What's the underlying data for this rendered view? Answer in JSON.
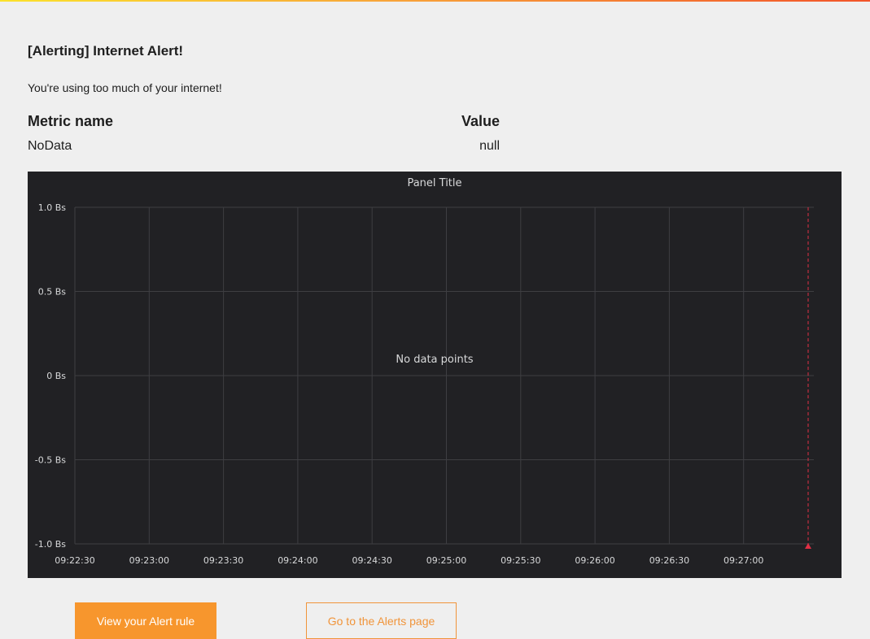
{
  "alert": {
    "title": "[Alerting] Internet Alert!",
    "message": "You're using too much of your internet!"
  },
  "metrics_table": {
    "headers": [
      "Metric name",
      "Value"
    ],
    "rows": [
      [
        "NoData",
        "null"
      ]
    ]
  },
  "chart_data": {
    "type": "line",
    "title": "Panel Title",
    "xlabel": "",
    "ylabel": "",
    "x_ticks": [
      "09:22:30",
      "09:23:00",
      "09:23:30",
      "09:24:00",
      "09:24:30",
      "09:25:00",
      "09:25:30",
      "09:26:00",
      "09:26:30",
      "09:27:00"
    ],
    "y_ticks": [
      1.0,
      0.5,
      0,
      -0.5,
      -1.0
    ],
    "y_tick_labels": [
      "1.0 Bs",
      "0.5 Bs",
      "0 Bs",
      "-0.5 Bs",
      "-1.0 Bs"
    ],
    "ylim": [
      -1.0,
      1.0
    ],
    "grid": true,
    "series": [],
    "no_data_text": "No data points",
    "alert_marker": {
      "color": "#e02f44"
    },
    "colors": {
      "background": "#212124",
      "grid": "#3e3e42",
      "text": "#d8d9da"
    }
  },
  "buttons": {
    "view_rule": "View your Alert rule",
    "alerts_page": "Go to the Alerts page"
  },
  "colors": {
    "accent": "#f7962d",
    "page_background": "#efefef"
  }
}
